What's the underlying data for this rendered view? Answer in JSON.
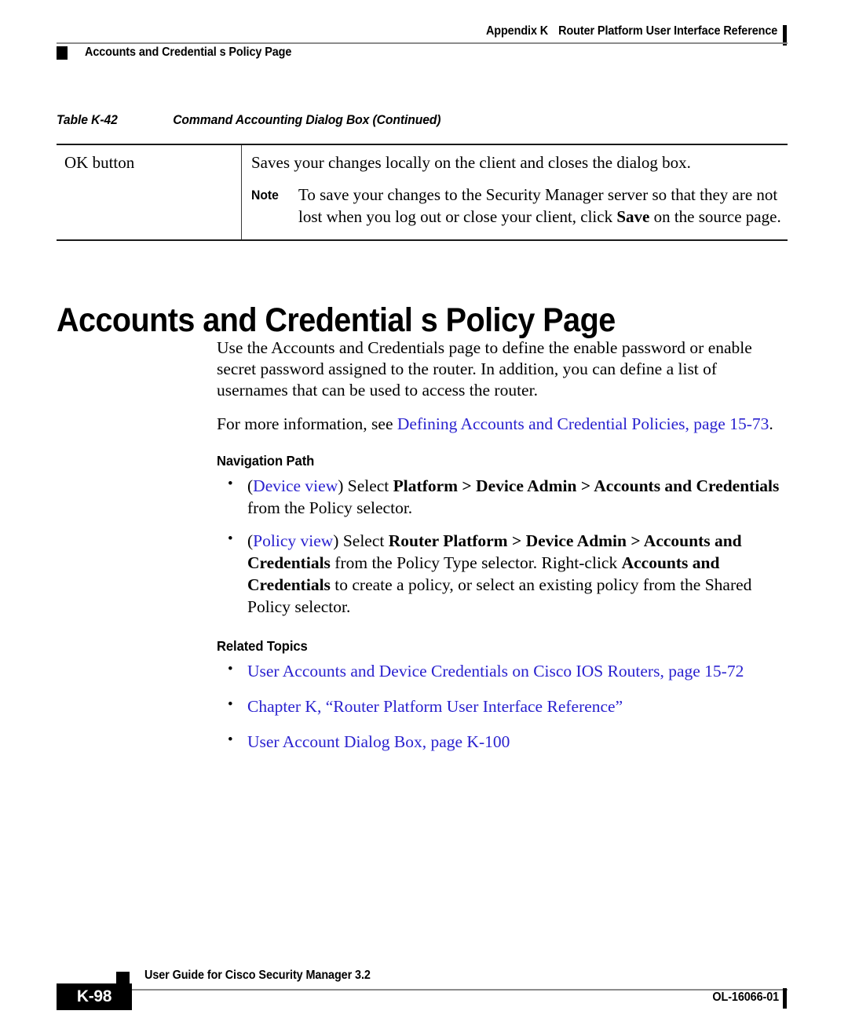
{
  "colors": {
    "link": "#2a22cf",
    "rule": "#8c8c8c",
    "ink": "#000000"
  },
  "header": {
    "appendix": "Appendix K",
    "chapter_reference": "Router Platform User Interface Reference",
    "running_title": "Accounts and Credential s Policy Page"
  },
  "table": {
    "caption_label": "Table K-42",
    "caption_title": "Command Accounting Dialog Box (Continued)",
    "rows": [
      {
        "term": "OK button",
        "description": "Saves your changes locally on the client and closes the dialog box.",
        "note_label": "Note",
        "note_text_1": "To save your changes to the Security Manager server so that they are not lost when you log out or close your client, click ",
        "note_bold": "Save",
        "note_text_2": " on the source page."
      }
    ]
  },
  "page_heading": "Accounts and Credential s Policy Page",
  "body": {
    "intro_paragraph": "Use the Accounts and Credentials page to define the enable password or enable secret password assigned to the router. In addition, you can define a list of usernames that can be used to access the router.",
    "more_info_prefix": "For more information, see ",
    "more_info_link": "Defining Accounts and Credential Policies, page 15-73",
    "more_info_suffix": "."
  },
  "navigation_path": {
    "heading": "Navigation Path",
    "items": [
      {
        "open_paren": "(",
        "view_link": "Device view",
        "close_paren": ") Select ",
        "bold_path": "Platform > Device Admin > Accounts and Credentials",
        "tail": " from the Policy selector."
      },
      {
        "open_paren": "(",
        "view_link": "Policy view",
        "close_paren": ") Select ",
        "bold_path": "Router Platform > Device Admin > Accounts and Credentials",
        "mid": " from the Policy Type selector. Right-click ",
        "bold_path_2": "Accounts and Credentials",
        "tail": " to create a policy, or select an existing policy from the Shared Policy selector."
      }
    ]
  },
  "related_topics": {
    "heading": "Related Topics",
    "items": [
      "User Accounts and Device Credentials on Cisco IOS Routers, page 15-72",
      "Chapter K, “Router Platform User Interface Reference”",
      "User Account Dialog Box, page K-100"
    ]
  },
  "footer": {
    "page_number": "K-98",
    "guide_title": "User Guide for Cisco Security Manager 3.2",
    "document_id": "OL-16066-01"
  }
}
